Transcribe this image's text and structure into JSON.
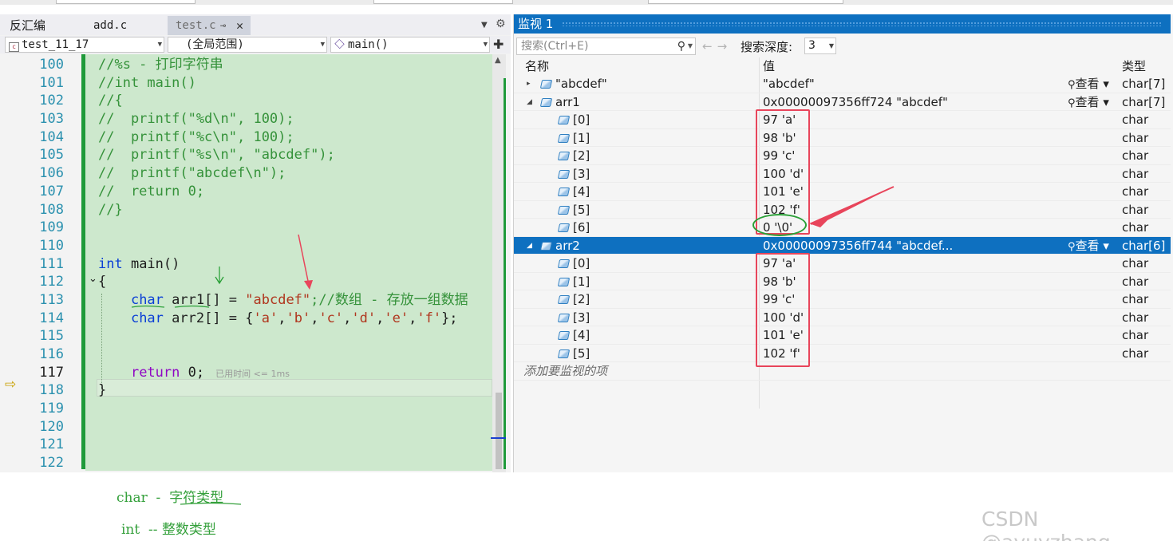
{
  "editor": {
    "tabs": [
      {
        "label": "反汇编",
        "active": false
      },
      {
        "label": "add.c",
        "active": false
      },
      {
        "label": "test.c",
        "active": true
      }
    ],
    "nav": {
      "project": "test_11_17",
      "scope": "(全局范围)",
      "function": "main()"
    },
    "line_numbers": [
      "100",
      "101",
      "102",
      "103",
      "104",
      "105",
      "106",
      "107",
      "108",
      "109",
      "110",
      "111",
      "112",
      "113",
      "114",
      "115",
      "116",
      "117",
      "118",
      "119",
      "120",
      "121",
      "122"
    ],
    "code_lines": {
      "l100": "//%s - 打印字符串",
      "l101": "//int main()",
      "l102": "//{",
      "l103": "//  printf(\"%d\\n\", 100);",
      "l104": "//  printf(\"%c\\n\", 100);",
      "l105": "//  printf(\"%s\\n\", \"abcdef\");",
      "l106": "//  printf(\"abcdef\\n\");",
      "l107": "//  return 0;",
      "l108": "//}",
      "l111_kw": "int",
      "l111_rest": " main()",
      "l112": "{",
      "l113_kw": "char",
      "l113_a": " arr1[] = ",
      "l113_str": "\"abcdef\"",
      "l113_cmt": ";//数组 - 存放一组数据",
      "l114_kw": "char",
      "l114_a": " arr2[] = {",
      "l114_chars": [
        "'a'",
        "'b'",
        "'c'",
        "'d'",
        "'e'",
        "'f'"
      ],
      "l114_end": "};",
      "l117_kw": "return",
      "l117_num": " 0;",
      "l117_hint": "已用时间 <= 1ms",
      "l118": "}"
    }
  },
  "watch": {
    "title": "监视 1",
    "search_placeholder": "搜索(Ctrl+E)",
    "depth_label": "搜索深度:",
    "depth_value": "3",
    "columns": {
      "name": "名称",
      "value": "值",
      "type": "类型"
    },
    "view_label": "查看",
    "rows": [
      {
        "level": 0,
        "expander": "▸",
        "name": "\"abcdef\"",
        "value": "\"abcdef\"",
        "type": "char[7]",
        "view": true,
        "selected": false
      },
      {
        "level": 0,
        "expander": "◢",
        "name": "arr1",
        "value": "0x00000097356ff724 \"abcdef\"",
        "type": "char[7]",
        "view": true,
        "selected": false
      },
      {
        "level": 1,
        "expander": "",
        "name": "[0]",
        "value": "97 'a'",
        "type": "char",
        "view": false,
        "selected": false
      },
      {
        "level": 1,
        "expander": "",
        "name": "[1]",
        "value": "98 'b'",
        "type": "char",
        "view": false,
        "selected": false
      },
      {
        "level": 1,
        "expander": "",
        "name": "[2]",
        "value": "99 'c'",
        "type": "char",
        "view": false,
        "selected": false
      },
      {
        "level": 1,
        "expander": "",
        "name": "[3]",
        "value": "100 'd'",
        "type": "char",
        "view": false,
        "selected": false
      },
      {
        "level": 1,
        "expander": "",
        "name": "[4]",
        "value": "101 'e'",
        "type": "char",
        "view": false,
        "selected": false
      },
      {
        "level": 1,
        "expander": "",
        "name": "[5]",
        "value": "102 'f'",
        "type": "char",
        "view": false,
        "selected": false
      },
      {
        "level": 1,
        "expander": "",
        "name": "[6]",
        "value": "0 '\\0'",
        "type": "char",
        "view": false,
        "selected": false
      },
      {
        "level": 0,
        "expander": "◢",
        "name": "arr2",
        "value": "0x00000097356ff744 \"abcdef...",
        "type": "char[6]",
        "view": true,
        "selected": true
      },
      {
        "level": 1,
        "expander": "",
        "name": "[0]",
        "value": "97 'a'",
        "type": "char",
        "view": false,
        "selected": false
      },
      {
        "level": 1,
        "expander": "",
        "name": "[1]",
        "value": "98 'b'",
        "type": "char",
        "view": false,
        "selected": false
      },
      {
        "level": 1,
        "expander": "",
        "name": "[2]",
        "value": "99 'c'",
        "type": "char",
        "view": false,
        "selected": false
      },
      {
        "level": 1,
        "expander": "",
        "name": "[3]",
        "value": "100 'd'",
        "type": "char",
        "view": false,
        "selected": false
      },
      {
        "level": 1,
        "expander": "",
        "name": "[4]",
        "value": "101 'e'",
        "type": "char",
        "view": false,
        "selected": false
      },
      {
        "level": 1,
        "expander": "",
        "name": "[5]",
        "value": "102 'f'",
        "type": "char",
        "view": false,
        "selected": false
      }
    ],
    "add_item_label": "添加要监视的项"
  },
  "notes": {
    "char_kw": "char",
    "char_sep": "-",
    "char_desc": "字符类型",
    "int_kw": "int",
    "int_sep": "--",
    "int_desc": "整数类型"
  },
  "watermark": "CSDN @ayuyzhang",
  "colors": {
    "accent": "#0e70c0",
    "editor_bg": "#cde8cd",
    "annotation_red": "#e8455b",
    "annotation_green": "#2aa037"
  }
}
